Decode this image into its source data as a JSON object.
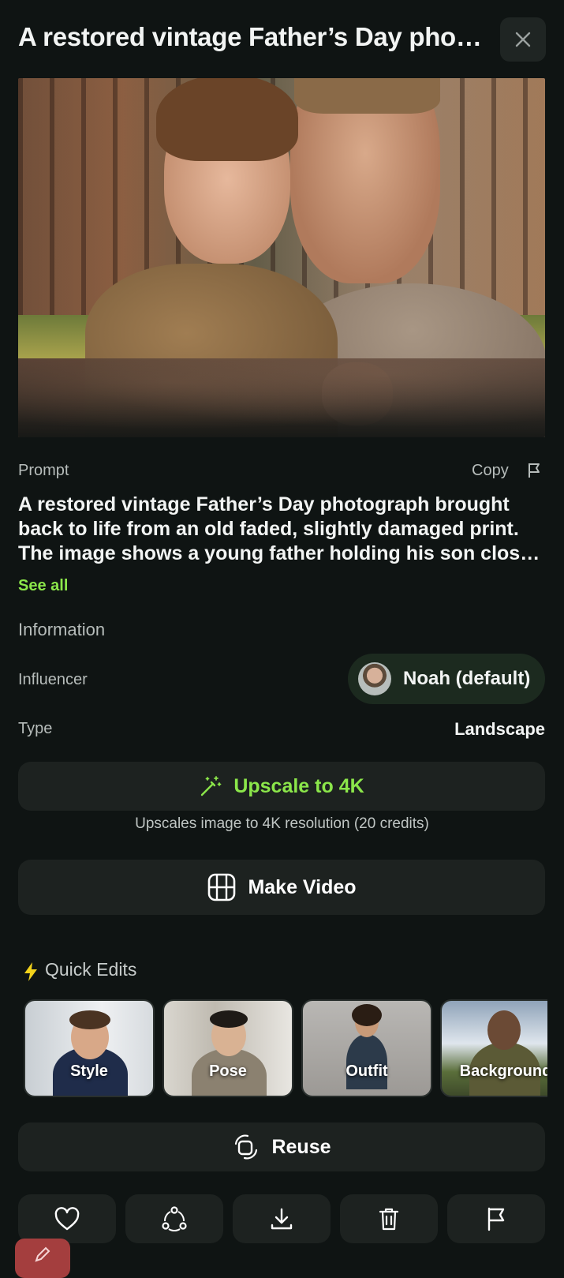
{
  "header": {
    "title": "A restored vintage Father’s Day photograph brought back to life from an old faded, slightly damaged print.",
    "close_icon": "close-icon"
  },
  "prompt": {
    "label": "Prompt",
    "copy_label": "Copy",
    "text": "A restored vintage Father’s Day photograph brought back to life from an old faded, slightly damaged print. The image shows a young father holding his son close in a backyard.",
    "see_all_label": "See all"
  },
  "information": {
    "heading": "Information",
    "influencer_label": "Influencer",
    "influencer_value": "Noah (default)",
    "type_label": "Type",
    "type_value": "Landscape"
  },
  "actions": {
    "upscale_label": "Upscale to 4K",
    "upscale_note": "Upscales image to 4K resolution (20 credits)",
    "make_video_label": "Make Video",
    "reuse_label": "Reuse"
  },
  "quick_edits": {
    "title": "Quick Edits",
    "items": [
      {
        "label": "Style"
      },
      {
        "label": "Pose"
      },
      {
        "label": "Outfit"
      },
      {
        "label": "Background"
      }
    ]
  },
  "bottom_bar": {
    "icons": [
      "heart-icon",
      "share-icon",
      "download-icon",
      "trash-icon",
      "flag-icon"
    ]
  },
  "colors": {
    "background": "#0f1413",
    "accent": "#8be64a",
    "surface": "#1d2220"
  }
}
